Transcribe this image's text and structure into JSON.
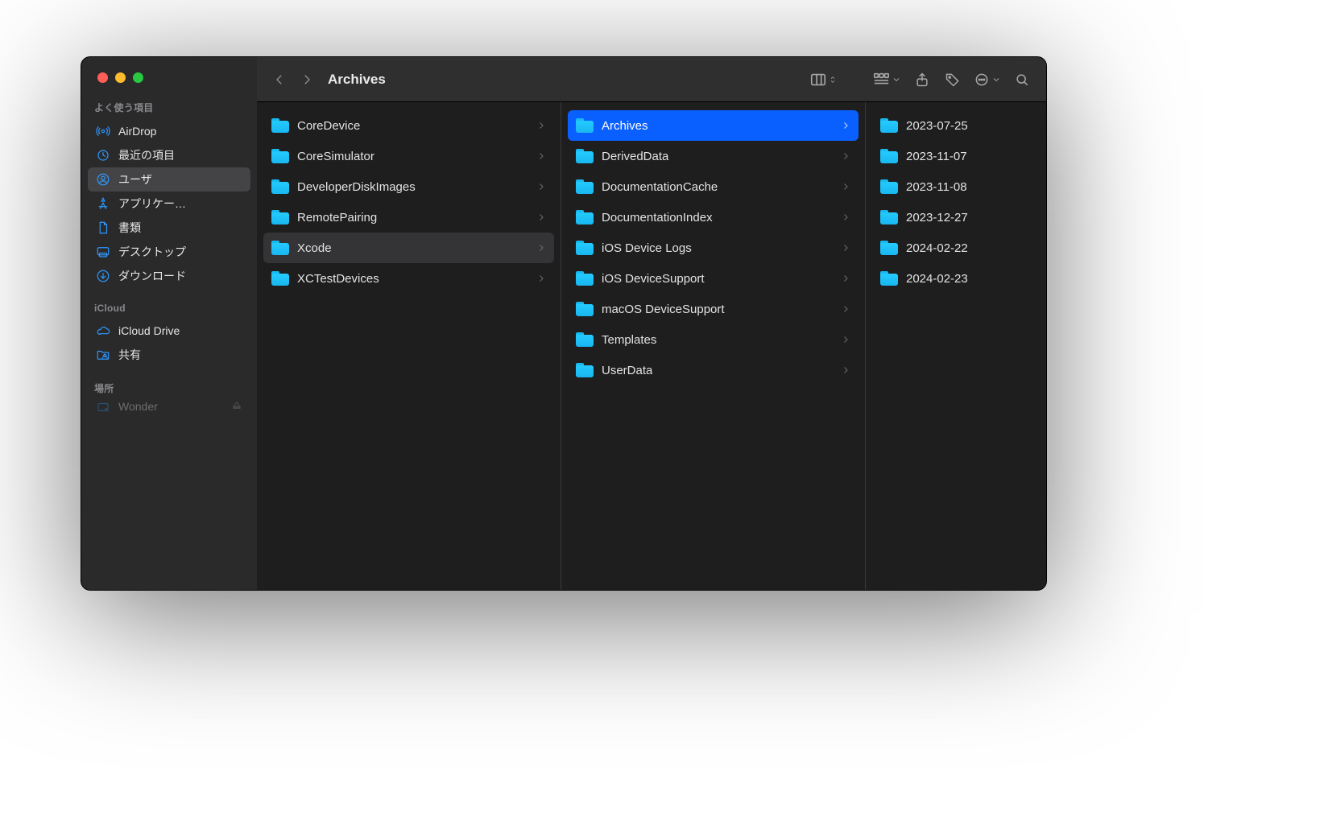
{
  "window": {
    "title": "Archives"
  },
  "sidebar": {
    "sections": [
      {
        "label": "よく使う項目",
        "items": [
          {
            "icon": "airdrop",
            "label": "AirDrop"
          },
          {
            "icon": "clock",
            "label": "最近の項目"
          },
          {
            "icon": "user",
            "label": "ユーザ",
            "selected": true
          },
          {
            "icon": "appstore",
            "label": "アプリケー…"
          },
          {
            "icon": "document",
            "label": "書類"
          },
          {
            "icon": "desktop",
            "label": "デスクトップ"
          },
          {
            "icon": "download",
            "label": "ダウンロード"
          }
        ]
      },
      {
        "label": "iCloud",
        "items": [
          {
            "icon": "cloud",
            "label": "iCloud Drive"
          },
          {
            "icon": "shared",
            "label": "共有"
          }
        ]
      },
      {
        "label": "場所",
        "items": [
          {
            "icon": "disk",
            "label": "Wonder",
            "eject": true,
            "cut": true
          }
        ]
      }
    ]
  },
  "columns": [
    {
      "items": [
        {
          "label": "CoreDevice"
        },
        {
          "label": "CoreSimulator"
        },
        {
          "label": "DeveloperDiskImages"
        },
        {
          "label": "RemotePairing"
        },
        {
          "label": "Xcode",
          "state": "dim"
        },
        {
          "label": "XCTestDevices"
        }
      ]
    },
    {
      "items": [
        {
          "label": "Archives",
          "state": "sel"
        },
        {
          "label": "DerivedData"
        },
        {
          "label": "DocumentationCache"
        },
        {
          "label": "DocumentationIndex"
        },
        {
          "label": "iOS Device Logs"
        },
        {
          "label": "iOS DeviceSupport"
        },
        {
          "label": "macOS DeviceSupport"
        },
        {
          "label": "Templates"
        },
        {
          "label": "UserData"
        }
      ]
    },
    {
      "items": [
        {
          "label": "2023-07-25"
        },
        {
          "label": "2023-11-07"
        },
        {
          "label": "2023-11-08"
        },
        {
          "label": "2023-12-27"
        },
        {
          "label": "2024-02-22"
        },
        {
          "label": "2024-02-23"
        }
      ]
    }
  ]
}
